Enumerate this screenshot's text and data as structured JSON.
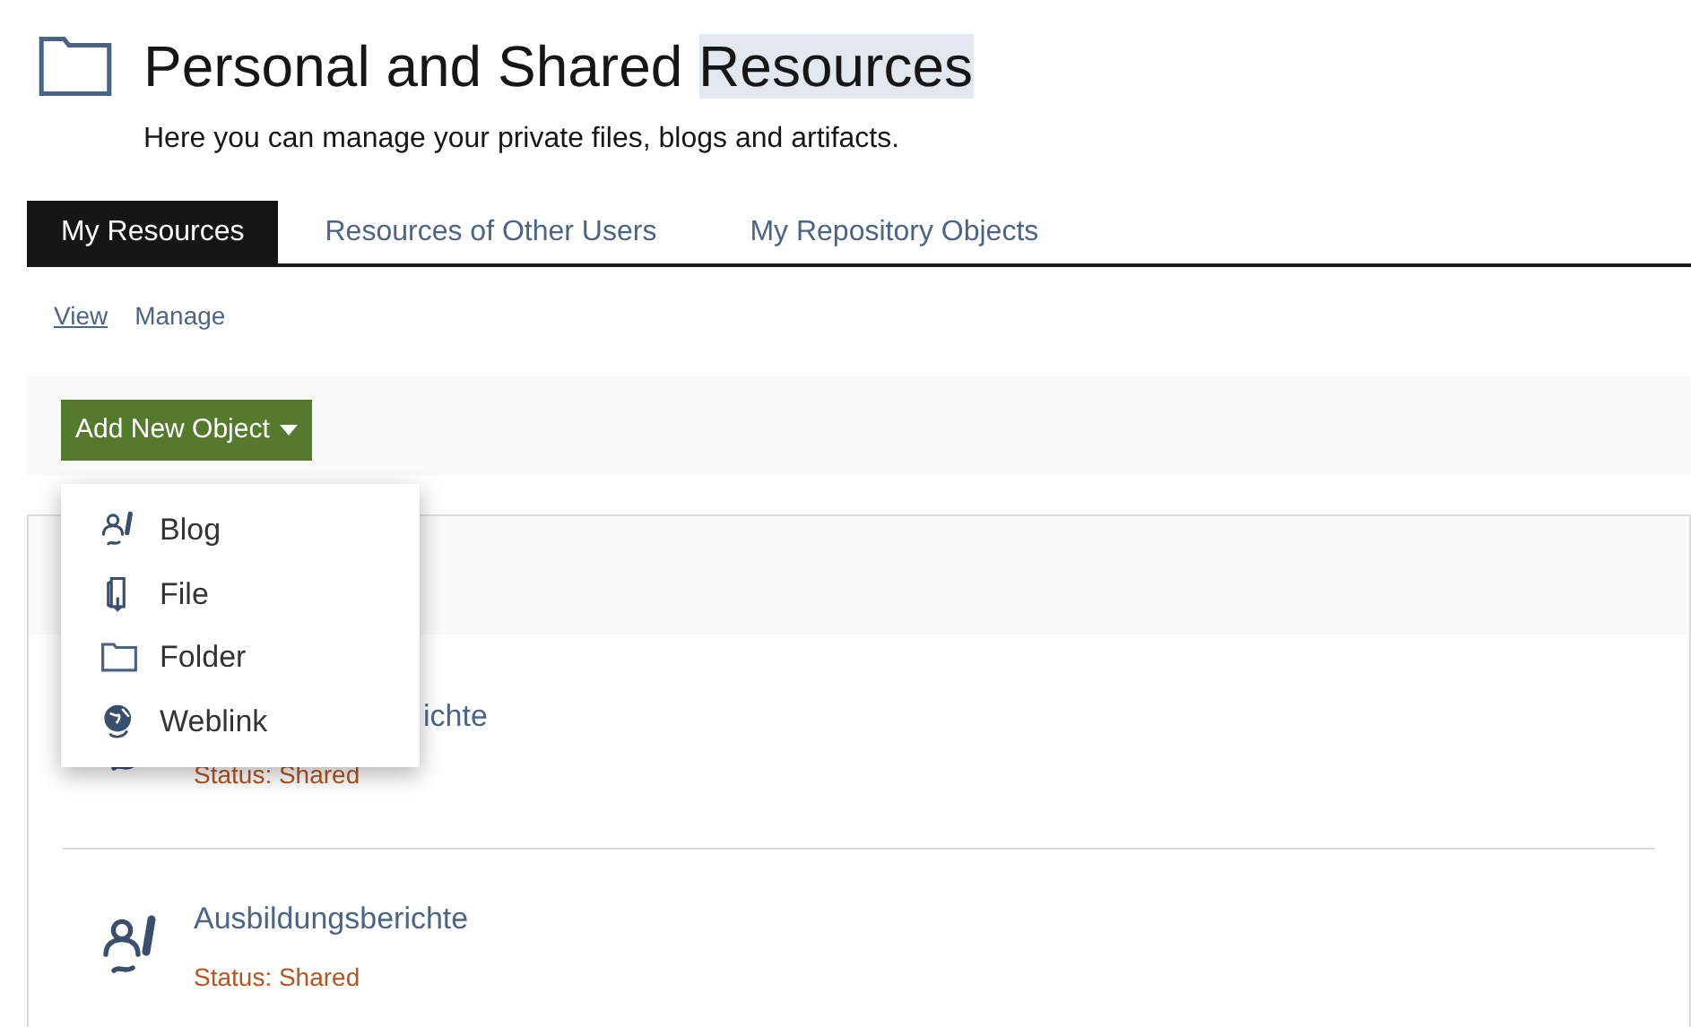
{
  "header": {
    "title_start": "Personal and Shared ",
    "title_highlight": "Resources",
    "subtitle": "Here you can manage your private files, blogs and artifacts."
  },
  "tabs": [
    {
      "label": "My Resources",
      "selected": true
    },
    {
      "label": "Resources of Other Users",
      "selected": false
    },
    {
      "label": "My Repository Objects",
      "selected": false
    }
  ],
  "subtabs": [
    {
      "label": "View",
      "selected": true
    },
    {
      "label": "Manage",
      "selected": false
    }
  ],
  "toolbar": {
    "button": "Add New Object"
  },
  "menu": [
    {
      "kind": "blog",
      "label": "Blog"
    },
    {
      "kind": "file",
      "label": "File"
    },
    {
      "kind": "folder",
      "label": "Folder"
    },
    {
      "kind": "weblink",
      "label": "Weblink"
    }
  ],
  "items": [
    {
      "kind": "blog",
      "title": "ichte",
      "partly_covered": true,
      "status": "Status: Shared"
    },
    {
      "kind": "blog",
      "title": "Ausbildungsberichte",
      "partly_covered": false,
      "status": "Status: Shared"
    }
  ]
}
